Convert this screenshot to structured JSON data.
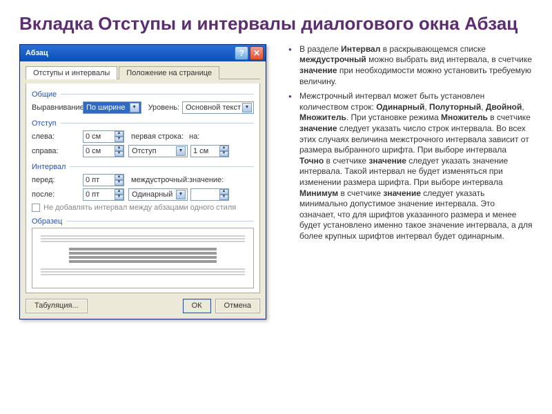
{
  "title": "Вкладка Отступы и интервалы диалогового окна Абзац",
  "dialog": {
    "window_title": "Абзац",
    "tabs": {
      "indents": "Отступы и интервалы",
      "position": "Положение на странице"
    },
    "groups": {
      "general": "Общие",
      "indent": "Отступ",
      "spacing": "Интервал",
      "preview": "Образец"
    },
    "labels": {
      "alignment": "Выравнивание:",
      "level": "Уровень:",
      "left": "слева:",
      "right": "справа:",
      "first_line": "первая строка:",
      "by": "на:",
      "before": "перед:",
      "after": "после:",
      "line_spacing": "междустрочный:",
      "at": "значение:"
    },
    "values": {
      "alignment": "По ширине",
      "level": "Основной текст",
      "left": "0 см",
      "right": "0 см",
      "first_line": "Отступ",
      "by": "1 см",
      "before": "0 пт",
      "after": "0 пт",
      "line_spacing": "Одинарный",
      "at": ""
    },
    "checkbox": "Не добавлять интервал между абзацами одного стиля",
    "buttons": {
      "tabs": "Табуляция...",
      "ok": "ОК",
      "cancel": "Отмена"
    }
  },
  "text": {
    "p1a": "В разделе ",
    "p1b": "Интервал",
    "p1c": " в раскрывающемся списке ",
    "p1d": "междустрочный",
    "p1e": " можно выбрать вид интервала, в счетчике ",
    "p1f": "значение",
    "p1g": " при необходимости можно установить требуемую величину.",
    "p2a": "Межстрочный интервал может быть установлен количеством строк: ",
    "p2b": "Одинарный",
    "p2c": ", ",
    "p2d": "Полуторный",
    "p2e": ", ",
    "p2f": "Двойной",
    "p2g": ", ",
    "p2h": "Множитель",
    "p2i": ". При установке режима ",
    "p2j": "Множитель",
    "p2k": " в счетчике ",
    "p2l": "значение",
    "p2m": " следует указать число строк интервала. Во всех этих случаях величина межстрочного интервала зависит от размера выбранного шрифта. При выборе интервала ",
    "p2n": "Точно",
    "p2o": " в счетчике ",
    "p2p": "значение",
    "p2q": " следует указать значение интервала. Такой интервал не будет изменяться при изменении размера шрифта. При выборе интервала ",
    "p2r": "Минимум",
    "p2s": " в счетчике ",
    "p2t": "значение",
    "p2u": " следует указать минимально допустимое значение интервала. Это означает, что для шрифтов указанного размера и менее будет установлено именно такое значение интервала, а для более крупных шрифтов интервал будет одинарным."
  }
}
